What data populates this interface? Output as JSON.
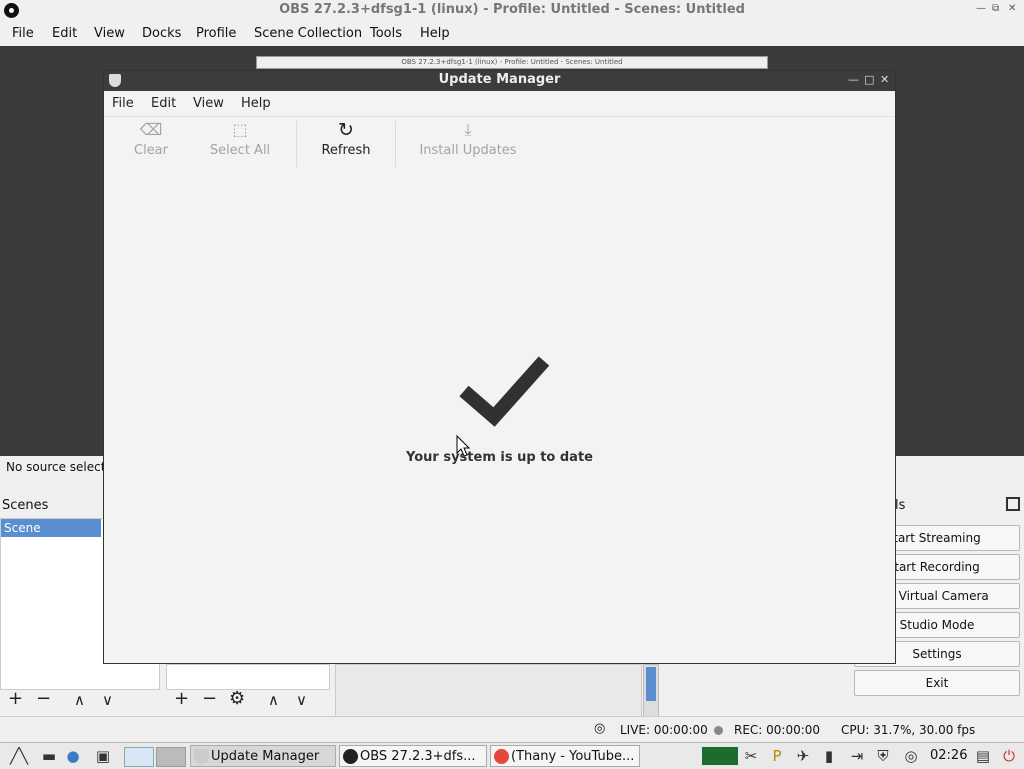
{
  "obs": {
    "title": "OBS 27.2.3+dfsg1-1 (linux) - Profile: Untitled - Scenes: Untitled",
    "menu": [
      "File",
      "Edit",
      "View",
      "Docks",
      "Profile",
      "Scene Collection",
      "Tools",
      "Help"
    ],
    "no_source": "No source select",
    "scenes_label": "Scenes",
    "scene_item": "Scene",
    "controls_label": "ls",
    "controls": [
      "tart Streaming",
      "tart Recording",
      "rt Virtual Camera",
      "Studio Mode",
      "Settings",
      "Exit"
    ],
    "status": {
      "live": "LIVE: 00:00:00",
      "rec": "REC: 00:00:00",
      "cpu": "CPU: 31.7%, 30.00 fps"
    },
    "mini_title": "OBS 27.2.3+dfsg1-1 (linux) - Profile: Untitled - Scenes: Untitled"
  },
  "update_manager": {
    "title": "Update Manager",
    "menu": [
      "File",
      "Edit",
      "View",
      "Help"
    ],
    "toolbar": {
      "clear": "Clear",
      "select_all": "Select All",
      "refresh": "Refresh",
      "install": "Install Updates"
    },
    "message": "Your system is up to date"
  },
  "taskbar": {
    "tasks": [
      "Update Manager",
      "OBS 27.2.3+dfs...",
      "(Thany - YouTube..."
    ],
    "clock": "02:26"
  },
  "colors": {
    "selection": "#5b8ed1",
    "um_titlebar": "#3c3c3c"
  }
}
